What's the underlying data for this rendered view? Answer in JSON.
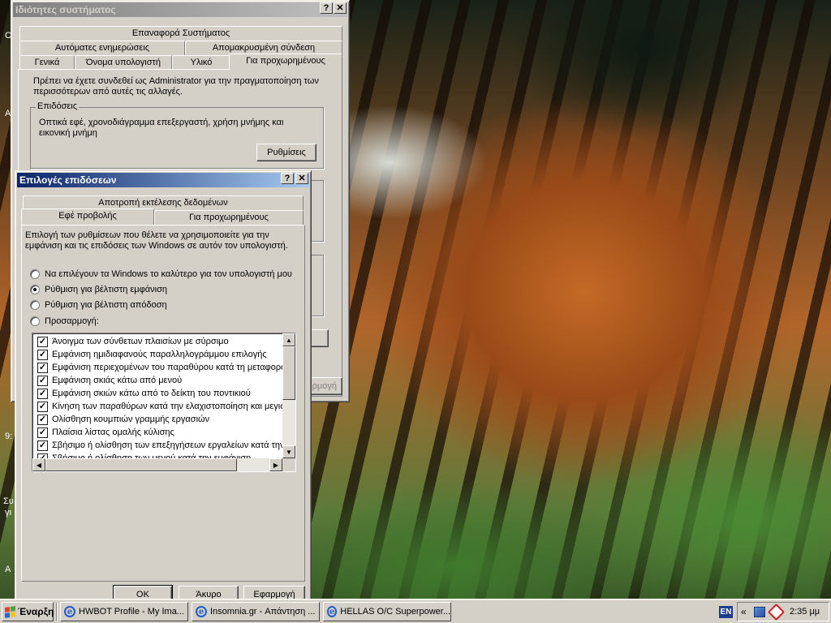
{
  "sysprops": {
    "title": "Ιδιότητες συστήματος",
    "close_glyph": "✕",
    "help_glyph": "?",
    "tabs_row1": [
      "Επαναφορά Συστήματος"
    ],
    "tabs_row2": [
      "Αυτόματες ενημερώσεις",
      "Απομακρυσμένη σύνδεση"
    ],
    "tabs_row3": [
      "Γενικά",
      "Όνομα υπολογιστή",
      "Υλικό",
      "Για προχωρημένους"
    ],
    "admin_note": "Πρέπει να έχετε συνδεθεί ως Administrator για την πραγματοποίηση των περισσότερων από αυτές τις αλλαγές.",
    "perf_group": "Επιδόσεις",
    "perf_desc": "Οπτικά εφέ, χρονοδιάγραμμα επεξεργαστή, χρήση μνήμης και εικονική μνήμη",
    "settings_button": "Ρυθμίσεις",
    "apply_partial": "ρμογή"
  },
  "perfopts": {
    "title": "Επιλογές επιδόσεων",
    "help_glyph": "?",
    "close_glyph": "✕",
    "tabs_row1": [
      "Αποτροπή εκτέλεσης δεδομένων"
    ],
    "tabs_row2": [
      "Εφέ προβολής",
      "Για προχωρημένους"
    ],
    "intro": "Επιλογή των ρυθμίσεων που θέλετε να χρησιμοποιείτε για την εμφάνιση και τις επιδόσεις των Windows σε αυτόν τον υπολογιστή.",
    "radios": [
      {
        "label": "Να επιλέγουν τα Windows το καλύτερο για τον υπολογιστή μου",
        "selected": false
      },
      {
        "label": "Ρύθμιση για βέλτιστη εμφάνιση",
        "selected": true
      },
      {
        "label": "Ρύθμιση για βέλτιστη απόδοση",
        "selected": false
      },
      {
        "label": "Προσαρμογή:",
        "selected": false
      }
    ],
    "check_glyph": "✓",
    "checks": [
      "Άνοιγμα των σύνθετων πλαισίων με σύρσιμο",
      "Εμφάνιση ημιδιαφανούς παραλληλογράμμου επιλογής",
      "Εμφάνιση περιεχομένων του παραθύρου κατά τη μεταφορά",
      "Εμφάνιση σκιάς κάτω από μενού",
      "Εμφάνιση σκιών κάτω από το δείκτη του ποντικιού",
      "Κίνηση των παραθύρων κατά την ελαχιστοποίηση και μεγιστοποίηση",
      "Ολίσθηση κουμπιών γραμμής εργασιών",
      "Πλαίσια λίστας ομαλής κύλισης",
      "Σβήσιμο ή ολίσθηση των επεξηγήσεων εργαλείων κατά την εμφάνιση",
      "Σβήσιμο ή ολίσθηση των μενού κατά την εμφάνιση"
    ],
    "ok": "OK",
    "cancel": "Άκυρο",
    "apply": "Εφαρμογή"
  },
  "taskbar": {
    "start": "Έναρξη",
    "tasks": [
      "HWBOT Profile - My Ima...",
      "Insomnia.gr - Απάντηση ...",
      "HELLAS O/C Superpower..."
    ],
    "lang": "EN",
    "tray_arrows": "«",
    "clock": "2:35 μμ"
  },
  "desktop_fragments": [
    "C",
    "A",
    "9:",
    "Συ",
    "γι",
    "A"
  ]
}
